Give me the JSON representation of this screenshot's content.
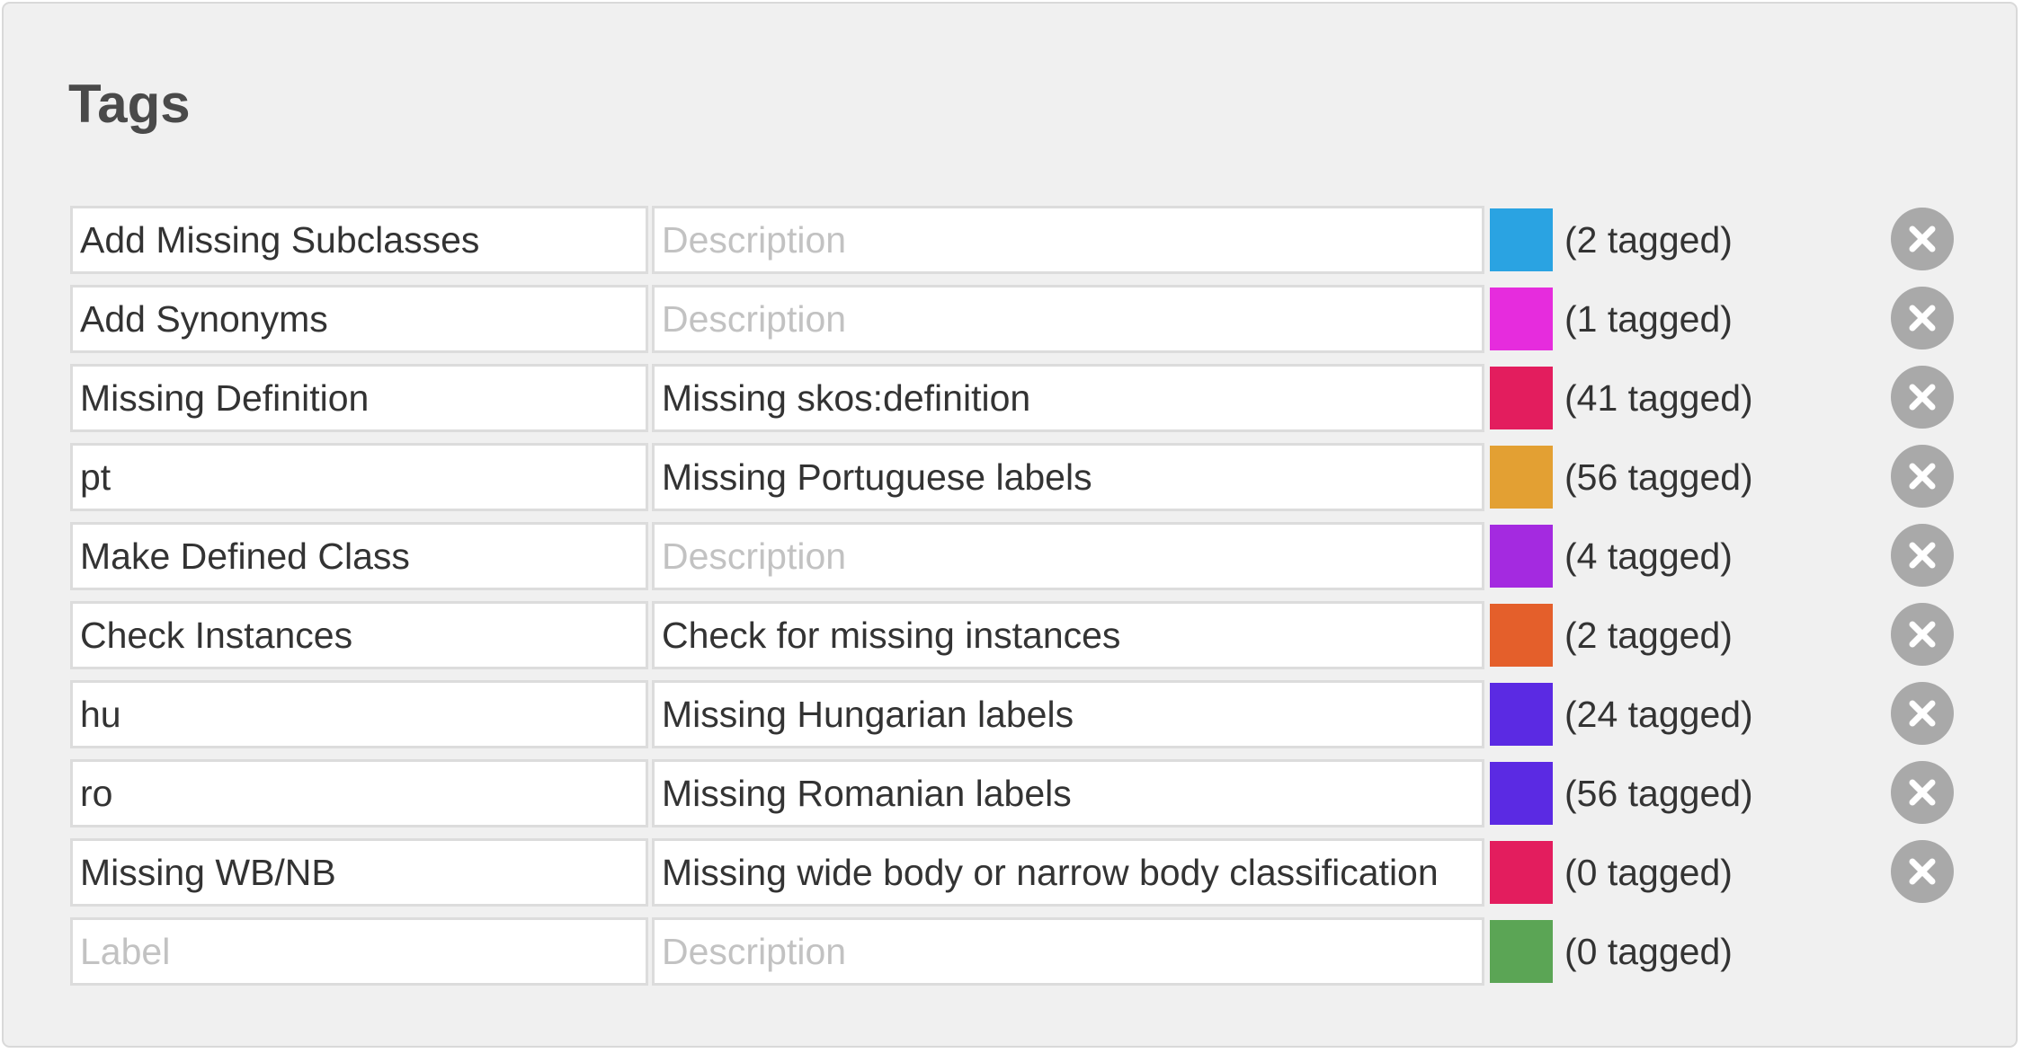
{
  "panel": {
    "title": "Tags"
  },
  "tags": [
    {
      "label": "Add Missing Subclasses",
      "description": "",
      "color": "#2aa3e2",
      "count_text": "(2 tagged)",
      "deletable": true
    },
    {
      "label": "Add Synonyms",
      "description": "",
      "color": "#e62cdd",
      "count_text": "(1 tagged)",
      "deletable": true
    },
    {
      "label": "Missing Definition",
      "description": "Missing skos:definition",
      "color": "#e31d5e",
      "count_text": "(41 tagged)",
      "deletable": true
    },
    {
      "label": "pt",
      "description": "Missing Portuguese labels",
      "color": "#e3a033",
      "count_text": "(56 tagged)",
      "deletable": true
    },
    {
      "label": "Make Defined Class",
      "description": "",
      "color": "#a42ae0",
      "count_text": "(4 tagged)",
      "deletable": true
    },
    {
      "label": "Check Instances",
      "description": "Check for missing instances",
      "color": "#e45f2b",
      "count_text": "(2 tagged)",
      "deletable": true
    },
    {
      "label": "hu",
      "description": "Missing Hungarian labels",
      "color": "#5b2ae3",
      "count_text": "(24 tagged)",
      "deletable": true
    },
    {
      "label": "ro",
      "description": "Missing Romanian labels",
      "color": "#5b2ae3",
      "count_text": "(56 tagged)",
      "deletable": true
    },
    {
      "label": "Missing WB/NB",
      "description": "Missing wide body or narrow body classification",
      "color": "#e31d5e",
      "count_text": "(0 tagged)",
      "deletable": true
    },
    {
      "label": "",
      "description": "",
      "color": "#5ba555",
      "count_text": "(0 tagged)",
      "deletable": false
    }
  ],
  "placeholders": {
    "label": "Label",
    "description": "Description"
  },
  "icons": {
    "delete": "close-icon"
  }
}
